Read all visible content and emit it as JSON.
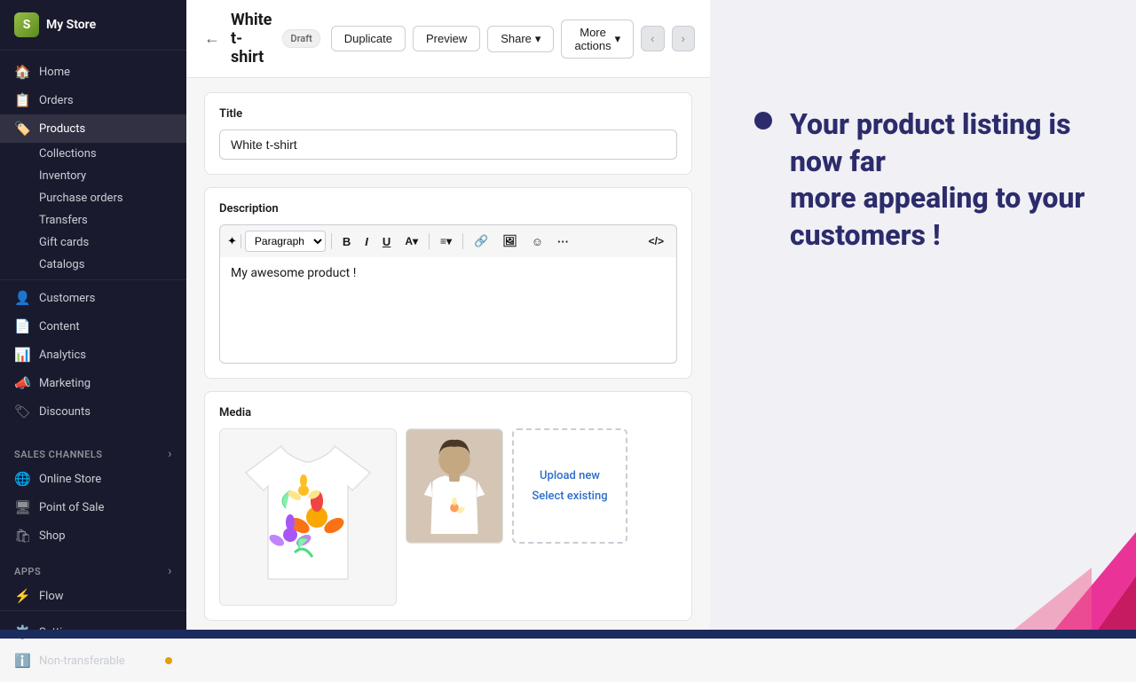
{
  "sidebar": {
    "logo": "S",
    "store_name": "My Store",
    "nav_items": [
      {
        "id": "home",
        "label": "Home",
        "icon": "🏠",
        "active": false
      },
      {
        "id": "orders",
        "label": "Orders",
        "icon": "📋",
        "active": false
      },
      {
        "id": "products",
        "label": "Products",
        "icon": "🏷️",
        "active": true
      }
    ],
    "products_sub": [
      {
        "id": "collections",
        "label": "Collections",
        "active": false
      },
      {
        "id": "inventory",
        "label": "Inventory",
        "active": false
      },
      {
        "id": "purchase_orders",
        "label": "Purchase orders",
        "active": false
      },
      {
        "id": "transfers",
        "label": "Transfers",
        "active": false
      },
      {
        "id": "gift_cards",
        "label": "Gift cards",
        "active": false
      },
      {
        "id": "catalogs",
        "label": "Catalogs",
        "active": false
      }
    ],
    "other_nav": [
      {
        "id": "customers",
        "label": "Customers",
        "icon": "👤",
        "active": false
      },
      {
        "id": "content",
        "label": "Content",
        "icon": "📄",
        "active": false
      },
      {
        "id": "analytics",
        "label": "Analytics",
        "icon": "📊",
        "active": false
      },
      {
        "id": "marketing",
        "label": "Marketing",
        "icon": "📣",
        "active": false
      },
      {
        "id": "discounts",
        "label": "Discounts",
        "icon": "🏷",
        "active": false
      }
    ],
    "sales_channels_label": "Sales channels",
    "sales_channels": [
      {
        "id": "online_store",
        "label": "Online Store",
        "icon": "🌐"
      },
      {
        "id": "pos",
        "label": "Point of Sale",
        "icon": "🖥"
      },
      {
        "id": "shop",
        "label": "Shop",
        "icon": "🛍"
      }
    ],
    "apps_label": "Apps",
    "apps": [
      {
        "id": "flow",
        "label": "Flow",
        "icon": "⚡"
      }
    ],
    "bottom_items": [
      {
        "id": "settings",
        "label": "Settings",
        "icon": "⚙️"
      },
      {
        "id": "non_transferable",
        "label": "Non-transferable",
        "icon": "ℹ️"
      }
    ]
  },
  "header": {
    "back_label": "←",
    "product_name": "White t-shirt",
    "status_badge": "Draft",
    "duplicate_label": "Duplicate",
    "preview_label": "Preview",
    "share_label": "Share",
    "more_actions_label": "More actions"
  },
  "product_form": {
    "title_label": "Title",
    "title_value": "White t-shirt",
    "description_label": "Description",
    "description_placeholder": "Paragraph",
    "description_content": "My awesome product !",
    "toolbar_buttons": [
      "B",
      "I",
      "U",
      "A",
      "≡",
      "🔗",
      "🖼",
      "☺",
      "···",
      "</>"
    ]
  },
  "media_section": {
    "title": "Media",
    "upload_new_label": "Upload new",
    "select_existing_label": "Select existing"
  },
  "feature": {
    "heading_line1": "Your product listing is now far",
    "heading_line2": "more appealing to your",
    "heading_line3": "customers !"
  }
}
